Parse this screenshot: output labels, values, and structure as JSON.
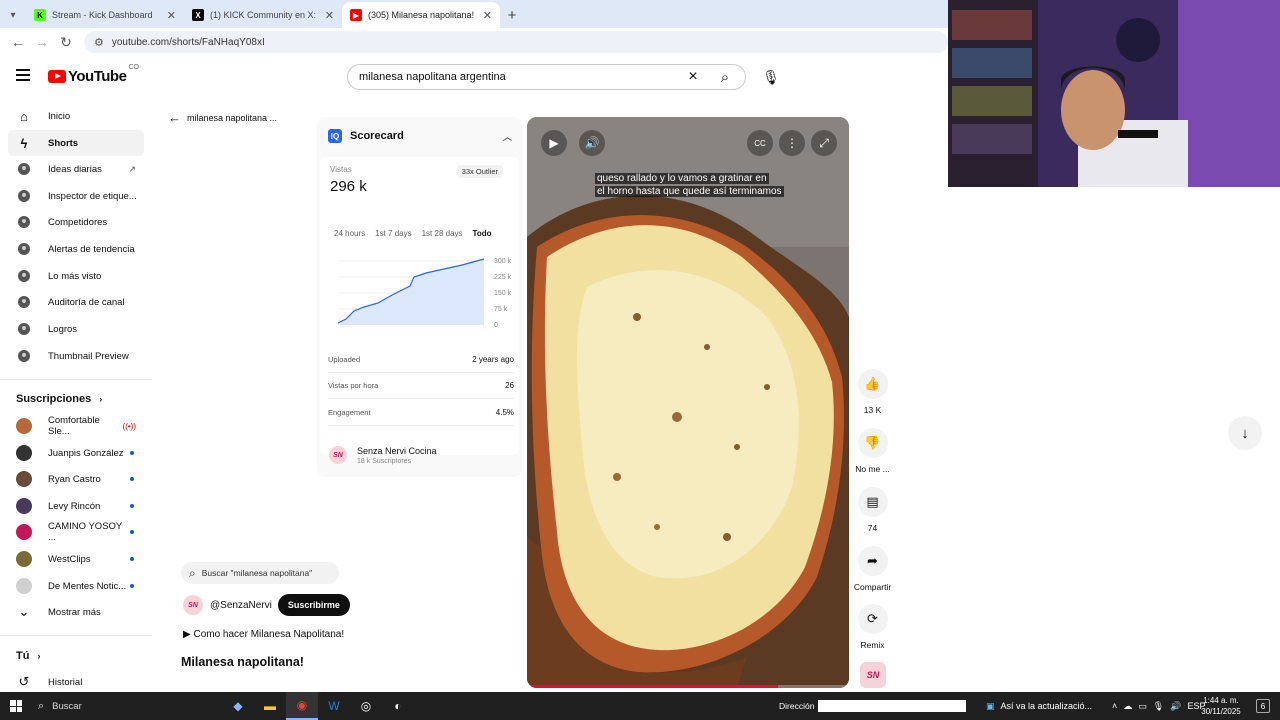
{
  "browser": {
    "tabs": [
      {
        "title": "Stream - Kick Dashboard",
        "favicon": "K",
        "color": "#53fc18"
      },
      {
        "title": "(1) KICK Community en X: \"nev",
        "favicon": "X",
        "color": "#000000"
      },
      {
        "title": "(305) Milanesa napolitana! - Yo",
        "favicon": "▶",
        "color": "#ff0000"
      }
    ],
    "url": "youtube.com/shorts/FaNHaqY08xI"
  },
  "header": {
    "logo_text": "YouTube",
    "logo_suffix": "CO",
    "search_value": "milanesa napolitana argentina"
  },
  "sidebar": {
    "main": [
      {
        "label": "Inicio",
        "icon": "home-icon",
        "glyph": "⌂"
      },
      {
        "label": "Shorts",
        "icon": "shorts-icon",
        "glyph": "ϟ"
      }
    ],
    "tools": [
      {
        "label": "Ideas diarias",
        "external": "↗"
      },
      {
        "label": "Inspector de etique..."
      },
      {
        "label": "Competidores"
      },
      {
        "label": "Alertas de tendencia"
      },
      {
        "label": "Lo más visto"
      },
      {
        "label": "Auditoría de canal"
      },
      {
        "label": "Logros"
      },
      {
        "label": "Thumbnail Preview"
      }
    ],
    "subscriptions_title": "Suscripciones",
    "subscriptions": [
      {
        "label": "Comfortable Sle...",
        "color": "#b56a3a",
        "live": "((•))"
      },
      {
        "label": "Juanpis González",
        "color": "#333333"
      },
      {
        "label": "Ryan Castro",
        "color": "#6a4b3a"
      },
      {
        "label": "Levy Rincón",
        "color": "#4a3a5a"
      },
      {
        "label": "CAMINO YOSOY ...",
        "color": "#c2185b"
      },
      {
        "label": "WestClips",
        "color": "#7a6a3a"
      },
      {
        "label": "De Mentes Notic...",
        "color": "#cfcfcf"
      }
    ],
    "show_more": "Mostrar más",
    "you_title": "Tú",
    "history": "Historial"
  },
  "back_title": "milanesa napolitana ...",
  "scorecard": {
    "title": "Scorecard",
    "views_label": "Vistas",
    "views_value": "296 k",
    "outlier": "33x Outlier",
    "periods": [
      "24 hours",
      "1st 7 days",
      "1st 28 days",
      "Todo"
    ],
    "y_ticks": [
      "300 k",
      "225 k",
      "150 k",
      "75 k",
      "0"
    ],
    "stats": [
      {
        "label": "Uploaded",
        "value": "2 years ago"
      },
      {
        "label": "Vistas por hora",
        "value": "26"
      },
      {
        "label": "Engagement",
        "value": "4.5%"
      }
    ],
    "channel_name": "Senza Nervi Cocina",
    "channel_subs": "18 k Suscriptores",
    "channel_initials": "SN"
  },
  "video": {
    "caption_line1": "queso rallado y lo vamos a gratinar en",
    "caption_line2": "el horno hasta que quede así terminamos",
    "progress": 0.78
  },
  "actions": [
    {
      "label": "13 K",
      "icon": "like-icon",
      "glyph": "👍"
    },
    {
      "label": "No me ...",
      "icon": "dislike-icon",
      "glyph": "👎"
    },
    {
      "label": "74",
      "icon": "comment-icon",
      "glyph": "▤"
    },
    {
      "label": "Compartir",
      "icon": "share-icon",
      "glyph": "➦"
    },
    {
      "label": "Remix",
      "icon": "remix-icon",
      "glyph": "⟳"
    }
  ],
  "meta": {
    "search_chip": "Buscar \"milanesa napolitana\"",
    "handle": "@SenzaNervi",
    "subscribe": "Suscribirme",
    "desc": "▶ Como hacer Milanesa Napolitana!",
    "title": "Milanesa napolitana!"
  },
  "taskbar": {
    "search": "Buscar",
    "direccion": "Dirección",
    "news": "Así va la actualizació...",
    "lang": "ESP",
    "time": "1:44 a. m.",
    "date": "30/11/2025",
    "notifications": "6"
  }
}
